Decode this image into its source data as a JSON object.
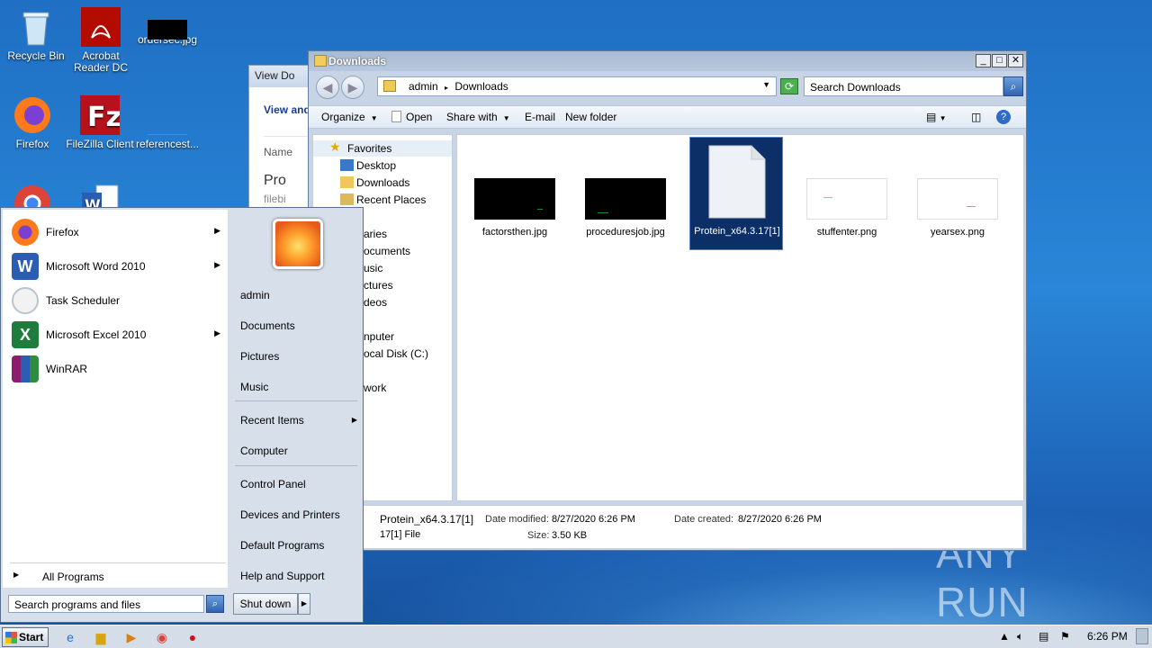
{
  "desktop": {
    "icons": [
      {
        "label": "Recycle Bin"
      },
      {
        "label": "Acrobat Reader DC"
      },
      {
        "label": "ordersec.jpg"
      },
      {
        "label": "Firefox"
      },
      {
        "label": "FileZilla Client"
      },
      {
        "label": "referencest..."
      }
    ],
    "watermark": "ANY RUN"
  },
  "bg_window": {
    "title": "View Do",
    "heading": "View and",
    "col_name": "Name",
    "item": "Pro",
    "item_sub": "filebi"
  },
  "explorer": {
    "title": "Downloads",
    "breadcrumb": {
      "root": "admin",
      "current": "Downloads"
    },
    "search_placeholder": "Search Downloads",
    "toolbar": {
      "organize": "Organize",
      "open": "Open",
      "share_with": "Share with",
      "email": "E-mail",
      "new_folder": "New folder"
    },
    "nav": {
      "favorites": "Favorites",
      "desktop": "Desktop",
      "downloads": "Downloads",
      "recent_places": "Recent Places",
      "libraries": "aries",
      "documents": "ocuments",
      "music": "usic",
      "pictures": "ctures",
      "videos": "deos",
      "computer": "nputer",
      "local_disk": "ocal Disk (C:)",
      "network": "work"
    },
    "files": [
      {
        "name": "factorsthen.jpg"
      },
      {
        "name": "proceduresjob.jpg"
      },
      {
        "name": "Protein_x64.3.17[1]"
      },
      {
        "name": "stuffenter.png"
      },
      {
        "name": "yearsex.png"
      }
    ],
    "details": {
      "name": "Protein_x64.3.17[1]",
      "type": "17[1] File",
      "modified_label": "Date modified:",
      "modified": "8/27/2020 6:26 PM",
      "created_label": "Date created:",
      "created": "8/27/2020 6:26 PM",
      "size_label": "Size:",
      "size": "3.50 KB"
    }
  },
  "start_menu": {
    "programs": [
      {
        "label": "Firefox"
      },
      {
        "label": "Microsoft Word 2010"
      },
      {
        "label": "Task Scheduler"
      },
      {
        "label": "Microsoft Excel 2010"
      },
      {
        "label": "WinRAR"
      }
    ],
    "all_programs": "All Programs",
    "search_placeholder": "Search programs and files",
    "right": {
      "user": "admin",
      "documents": "Documents",
      "pictures": "Pictures",
      "music": "Music",
      "recent_items": "Recent Items",
      "computer": "Computer",
      "control_panel": "Control Panel",
      "devices_printers": "Devices and Printers",
      "default_programs": "Default Programs",
      "help_support": "Help and Support"
    },
    "shutdown": "Shut down"
  },
  "taskbar": {
    "start": "Start",
    "clock": "6:26 PM"
  }
}
